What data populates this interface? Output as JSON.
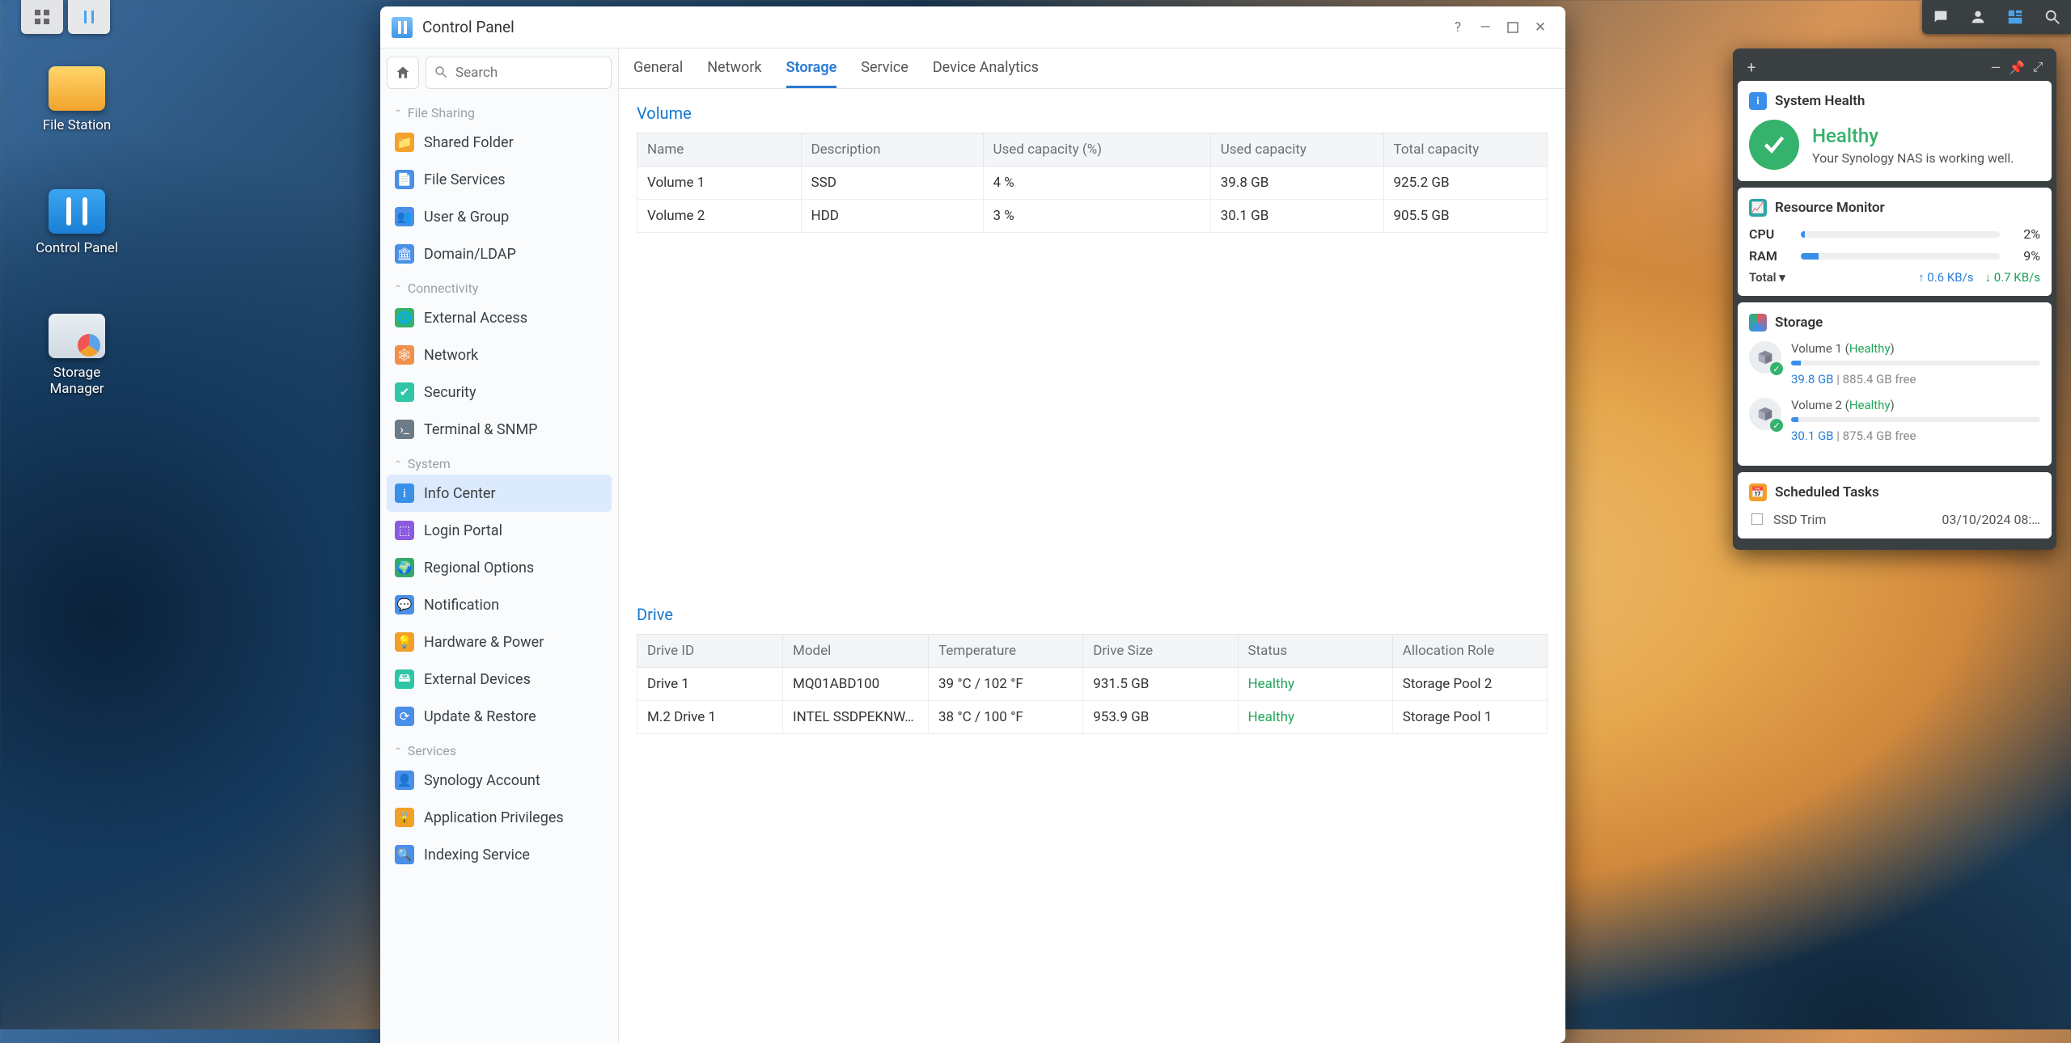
{
  "taskbar": {
    "app1": "menu",
    "app2": "control-panel"
  },
  "desktop_icons": {
    "file_station": "File Station",
    "control_panel": "Control Panel",
    "storage_manager": "Storage Manager"
  },
  "window": {
    "title": "Control Panel",
    "search_placeholder": "Search",
    "tabs": [
      "General",
      "Network",
      "Storage",
      "Service",
      "Device Analytics"
    ],
    "active_tab_index": 2
  },
  "sidebar": {
    "sections": {
      "file_sharing": {
        "title": "File Sharing",
        "items": [
          "Shared Folder",
          "File Services",
          "User & Group",
          "Domain/LDAP"
        ]
      },
      "connectivity": {
        "title": "Connectivity",
        "items": [
          "External Access",
          "Network",
          "Security",
          "Terminal & SNMP"
        ]
      },
      "system": {
        "title": "System",
        "items": [
          "Info Center",
          "Login Portal",
          "Regional Options",
          "Notification",
          "Hardware & Power",
          "External Devices",
          "Update & Restore"
        ]
      },
      "services": {
        "title": "Services",
        "items": [
          "Synology Account",
          "Application Privileges",
          "Indexing Service"
        ]
      }
    },
    "selected": "Info Center"
  },
  "volume_section": {
    "title": "Volume",
    "headers": [
      "Name",
      "Description",
      "Used capacity (%)",
      "Used capacity",
      "Total capacity"
    ],
    "rows": [
      {
        "name": "Volume 1",
        "desc": "SSD",
        "pct": "4 %",
        "used": "39.8 GB",
        "total": "925.2 GB"
      },
      {
        "name": "Volume 2",
        "desc": "HDD",
        "pct": "3 %",
        "used": "30.1 GB",
        "total": "905.5 GB"
      }
    ]
  },
  "drive_section": {
    "title": "Drive",
    "headers": [
      "Drive ID",
      "Model",
      "Temperature",
      "Drive Size",
      "Status",
      "Allocation Role"
    ],
    "rows": [
      {
        "id": "Drive 1",
        "model": "MQ01ABD100",
        "temp": "39 °C / 102 °F",
        "size": "931.5 GB",
        "status": "Healthy",
        "role": "Storage Pool 2"
      },
      {
        "id": "M.2 Drive 1",
        "model": "INTEL SSDPEKNW…",
        "temp": "38 °C / 100 °F",
        "size": "953.9 GB",
        "status": "Healthy",
        "role": "Storage Pool 1"
      }
    ]
  },
  "widgets": {
    "system_health": {
      "title": "System Health",
      "status": "Healthy",
      "message": "Your Synology NAS is working well."
    },
    "resource_monitor": {
      "title": "Resource Monitor",
      "cpu_label": "CPU",
      "cpu_pct": "2%",
      "cpu_fill": 2,
      "ram_label": "RAM",
      "ram_pct": "9%",
      "ram_fill": 9,
      "total_label": "Total",
      "up": "0.6 KB/s",
      "down": "0.7 KB/s"
    },
    "storage": {
      "title": "Storage",
      "volumes": [
        {
          "name": "Volume 1",
          "status": "Healthy",
          "fill": 4,
          "used": "39.8 GB",
          "free": "885.4 GB free"
        },
        {
          "name": "Volume 2",
          "status": "Healthy",
          "fill": 3,
          "used": "30.1 GB",
          "free": "875.4 GB free"
        }
      ]
    },
    "scheduled": {
      "title": "Scheduled Tasks",
      "task_name": "SSD Trim",
      "task_time": "03/10/2024 08:…"
    }
  }
}
